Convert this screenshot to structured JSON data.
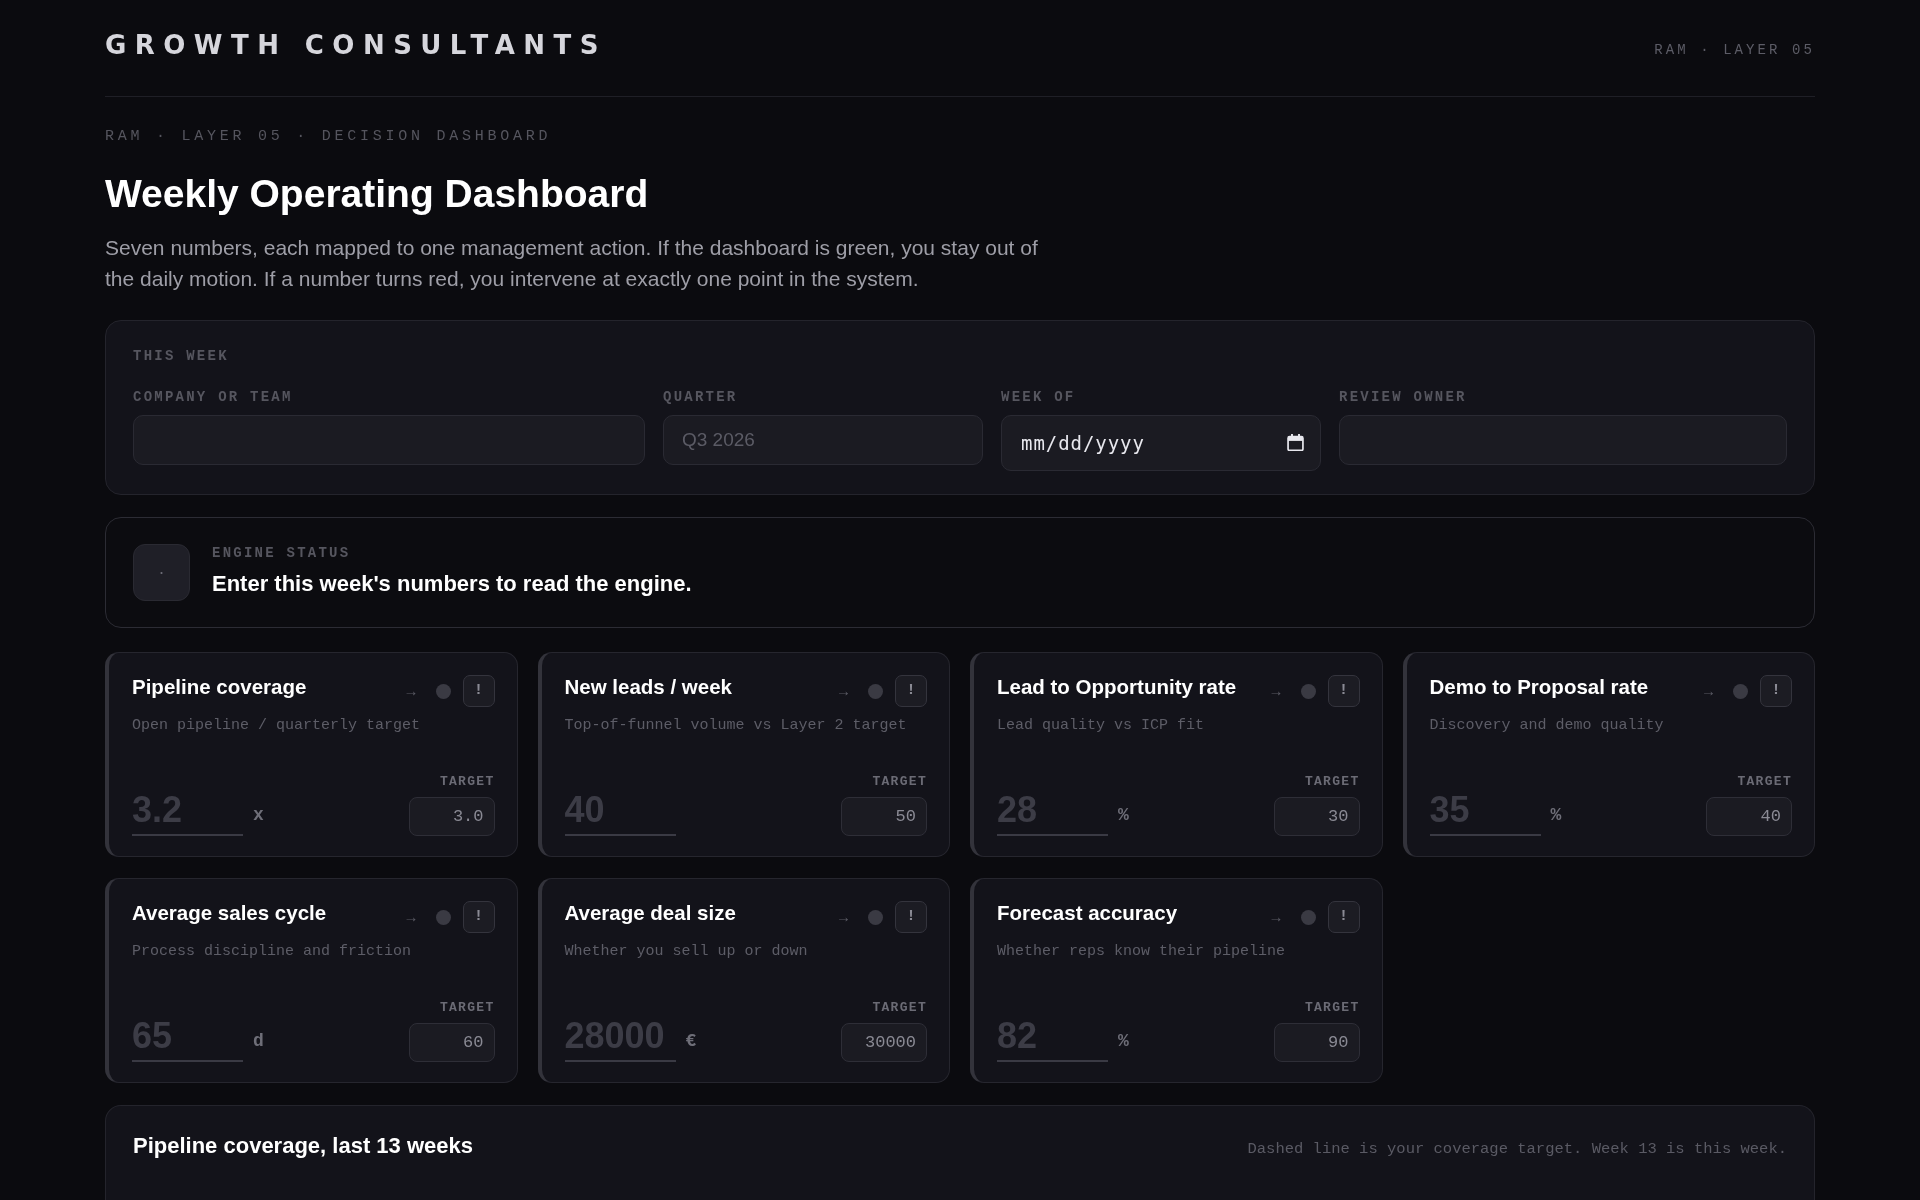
{
  "header": {
    "logo": "GROWTH CONSULTANTS",
    "tag": "RAM · LAYER 05"
  },
  "intro": {
    "eyebrow": "RAM · LAYER 05 · DECISION DASHBOARD",
    "title": "Weekly Operating Dashboard",
    "description": "Seven numbers, each mapped to one management action. If the dashboard is green, you stay out of the daily motion. If a number turns red, you intervene at exactly one point in the system."
  },
  "this_week": {
    "heading": "THIS WEEK",
    "fields": [
      {
        "kind": "text",
        "label": "COMPANY OR TEAM"
      },
      {
        "kind": "text",
        "label": "QUARTER",
        "placeholder": "Q3 2026"
      },
      {
        "kind": "date",
        "label": "WEEK OF",
        "placeholder": "mm/dd/yyyy"
      },
      {
        "kind": "text",
        "label": "REVIEW OWNER"
      }
    ]
  },
  "engine_status": {
    "indicator": "·",
    "label": "ENGINE STATUS",
    "message": "Enter this week's numbers to read the engine."
  },
  "metrics": [
    {
      "title": "Pipeline coverage",
      "description": "Open pipeline / quarterly target",
      "trend": "→",
      "action": "!",
      "placeholder": "3.2",
      "unit": "x",
      "target_label": "TARGET",
      "target": "3.0"
    },
    {
      "title": "New leads / week",
      "description": "Top-of-funnel volume vs Layer 2 target",
      "trend": "→",
      "action": "!",
      "placeholder": "40",
      "target_label": "TARGET",
      "target": "50"
    },
    {
      "title": "Lead to Opportunity rate",
      "description": "Lead quality vs ICP fit",
      "trend": "→",
      "action": "!",
      "placeholder": "28",
      "unit": "%",
      "target_label": "TARGET",
      "target": "30"
    },
    {
      "title": "Demo to Proposal rate",
      "description": "Discovery and demo quality",
      "trend": "→",
      "action": "!",
      "placeholder": "35",
      "unit": "%",
      "target_label": "TARGET",
      "target": "40"
    },
    {
      "title": "Average sales cycle",
      "description": "Process discipline and friction",
      "trend": "→",
      "action": "!",
      "placeholder": "65",
      "unit": "d",
      "target_label": "TARGET",
      "target": "60"
    },
    {
      "title": "Average deal size",
      "description": "Whether you sell up or down",
      "trend": "→",
      "action": "!",
      "placeholder": "28000",
      "unit": "€",
      "target_label": "TARGET",
      "target": "30000"
    },
    {
      "title": "Forecast accuracy",
      "description": "Whether reps know their pipeline",
      "trend": "→",
      "action": "!",
      "placeholder": "82",
      "unit": "%",
      "target_label": "TARGET",
      "target": "90"
    }
  ],
  "chart_panel": {
    "title": "Pipeline coverage, last 13 weeks",
    "note": "Dashed line is your coverage target. Week 13 is this week."
  }
}
